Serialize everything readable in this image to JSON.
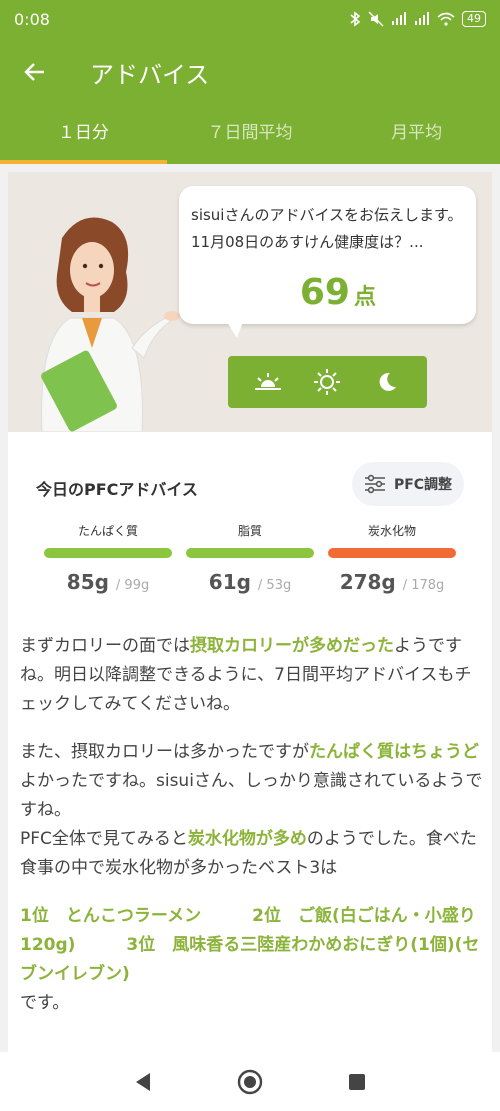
{
  "status": {
    "time": "0:08",
    "battery": "49"
  },
  "appbar": {
    "title": "アドバイス"
  },
  "tabs": [
    "１日分",
    "７日間平均",
    "月平均"
  ],
  "bubble": {
    "message": "sisuiさんのアドバイスをお伝えします。11月08日のあすけん健康度は？...",
    "score": "69",
    "score_unit": "点"
  },
  "pfc": {
    "title": "今日のPFCアドバイス",
    "adjust_label": "PFC調整",
    "items": [
      {
        "label": "たんぱく質",
        "value": "85g",
        "target": "/ 99g",
        "color": "#8cc63f",
        "ratio": 0.86
      },
      {
        "label": "脂質",
        "value": "61g",
        "target": "/ 53g",
        "color": "#8cc63f",
        "ratio": 1.0
      },
      {
        "label": "炭水化物",
        "value": "278g",
        "target": "/ 178g",
        "color": "#f26b35",
        "ratio": 1.0
      }
    ]
  },
  "advice": {
    "p1a": "まずカロリーの面では",
    "p1b": "摂取カロリーが多めだった",
    "p1c": "ようですね。明日以降調整できるように、7日間平均アドバイスもチェックしてみてくださいね。",
    "p2a": "また、摂取カロリーは多かったですが",
    "p2b": "たんぱく質はちょうど",
    "p2c": "よかったですね。sisuiさん、しっかり意識されているようですね。",
    "p2d": "PFC全体で見てみると",
    "p2e": "炭水化物が多め",
    "p2f": "のようでした。食べた食事の中で炭水化物が多かったベスト3は",
    "ranks": "1位　とんこつラーメン　　　2位　ご飯(白ごはん・小盛り120g)　　　3位　風味香る三陸産わかめおにぎり(1個)(セブンイレブン)",
    "ending": "です。"
  },
  "colors": {
    "brand": "#7cb032",
    "accent": "#f2b233",
    "warning": "#f26b35"
  }
}
